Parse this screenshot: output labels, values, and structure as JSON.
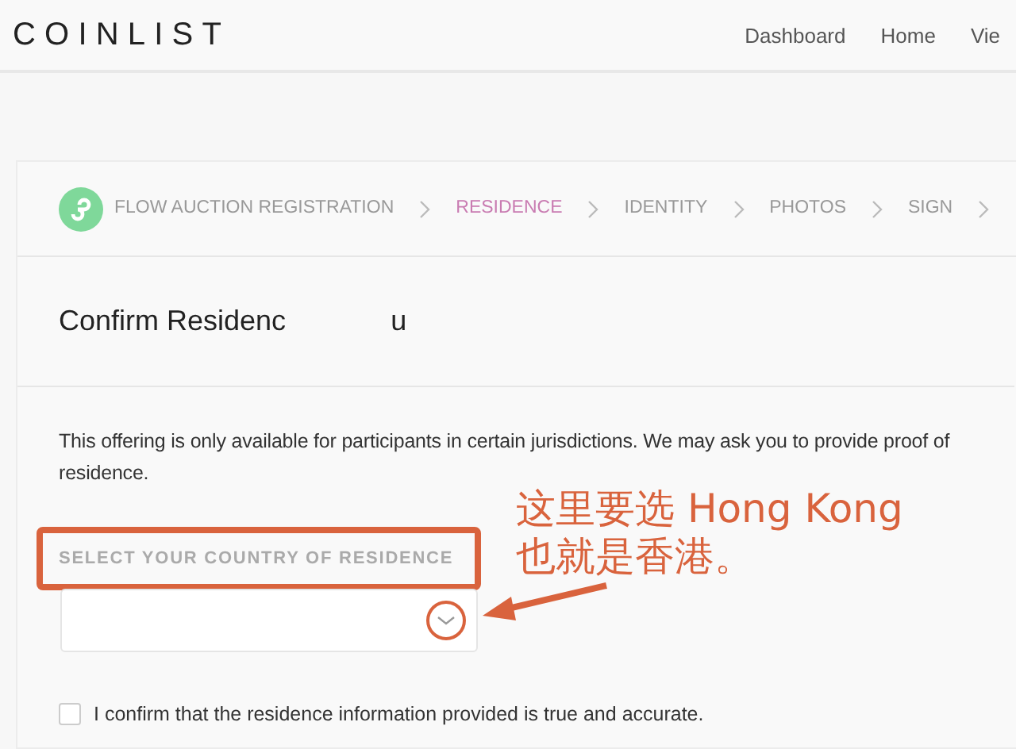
{
  "header": {
    "logo": "COINLIST",
    "nav": [
      {
        "label": "Dashboard"
      },
      {
        "label": "Home"
      },
      {
        "label": "Vie"
      }
    ]
  },
  "steps": [
    {
      "label": "FLOW AUCTION REGISTRATION",
      "selected": false
    },
    {
      "label": "RESIDENCE",
      "selected": true
    },
    {
      "label": "IDENTITY",
      "selected": false
    },
    {
      "label": "PHOTOS",
      "selected": false
    },
    {
      "label": "SIGN",
      "selected": false
    }
  ],
  "title": [
    "Confirm Residenc",
    "u"
  ],
  "description": "This offering is only available for participants in certain jurisdictions. We may ask you to provide proof of residence.",
  "country_field": {
    "label": "SELECT YOUR COUNTRY OF RESIDENCE"
  },
  "confirm_checkbox": {
    "label": "I confirm that the residence information provided is true and accurate.",
    "checked": false
  },
  "annotation": [
    "这里要选 Hong Kong",
    "也就是香港。"
  ]
}
